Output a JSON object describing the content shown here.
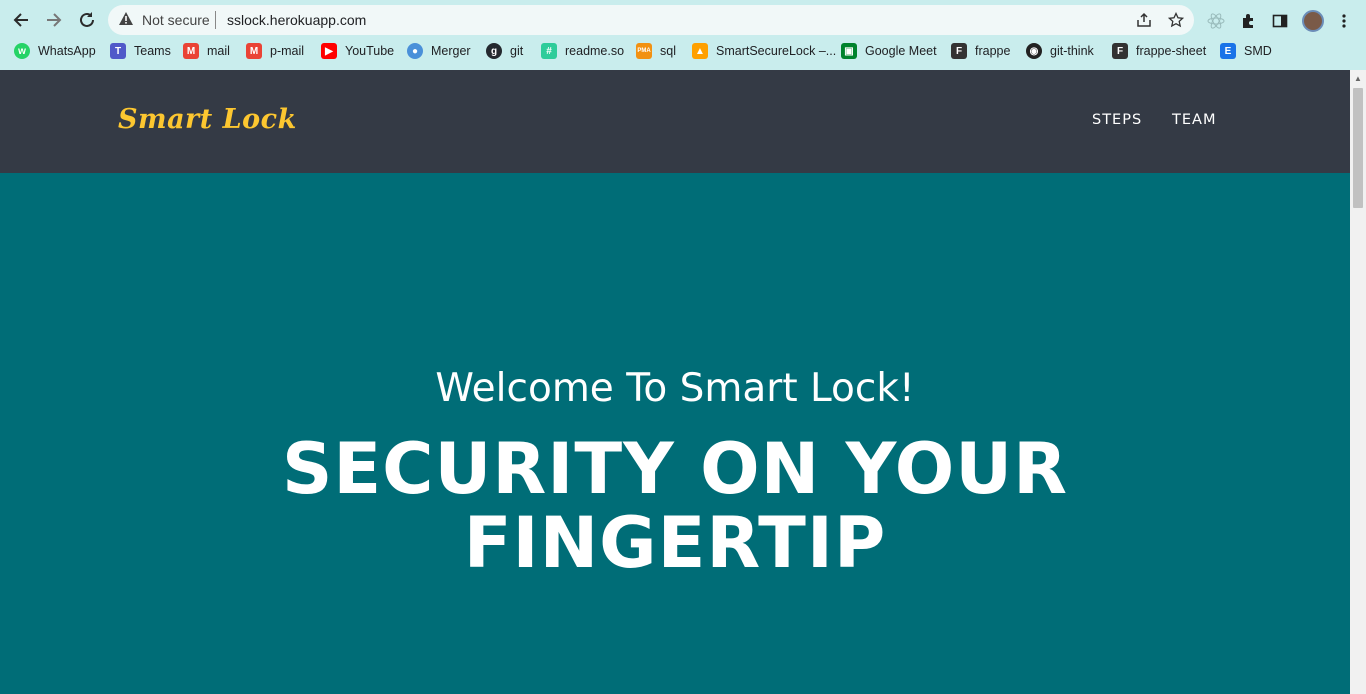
{
  "browser": {
    "security_label": "Not secure",
    "url": "sslock.herokuapp.com",
    "bookmarks": [
      {
        "label": "WhatsApp",
        "icon": "whatsapp-icon",
        "color": "#25d366"
      },
      {
        "label": "Teams",
        "icon": "teams-icon",
        "color": "#5059c9"
      },
      {
        "label": "mail",
        "icon": "gmail-icon",
        "color": "#ea4335"
      },
      {
        "label": "p-mail",
        "icon": "gmail-icon",
        "color": "#ea4335"
      },
      {
        "label": "YouTube",
        "icon": "youtube-icon",
        "color": "#ff0000"
      },
      {
        "label": "Merger",
        "icon": "merger-icon",
        "color": "#4a90d9"
      },
      {
        "label": "git",
        "icon": "github-icon",
        "color": "#24292f"
      },
      {
        "label": "readme.so",
        "icon": "readme-icon",
        "color": "#2ecc9a"
      },
      {
        "label": "sql",
        "icon": "phpmyadmin-icon",
        "color": "#f29111"
      },
      {
        "label": "SmartSecureLock –...",
        "icon": "firebase-icon",
        "color": "#ffa000"
      },
      {
        "label": "Google Meet",
        "icon": "google-meet-icon",
        "color": "#00832d"
      },
      {
        "label": "frappe",
        "icon": "frappe-icon",
        "color": "#333333"
      },
      {
        "label": "git-think",
        "icon": "globe-icon",
        "color": "#222222"
      },
      {
        "label": "frappe-sheet",
        "icon": "frappe-icon",
        "color": "#333333"
      },
      {
        "label": "SMD",
        "icon": "smd-icon",
        "color": "#1a73e8"
      }
    ]
  },
  "site": {
    "brand": "Smart Lock",
    "nav": [
      "STEPS",
      "TEAM"
    ],
    "hero_subtitle": "Welcome To Smart Lock!",
    "hero_title_line1": "SECURITY ON YOUR",
    "hero_title_line2": "FINGERTIP"
  },
  "colors": {
    "chrome": "#c9eded",
    "navbar": "#343a45",
    "brand": "#fdc730",
    "hero": "#006d77"
  }
}
